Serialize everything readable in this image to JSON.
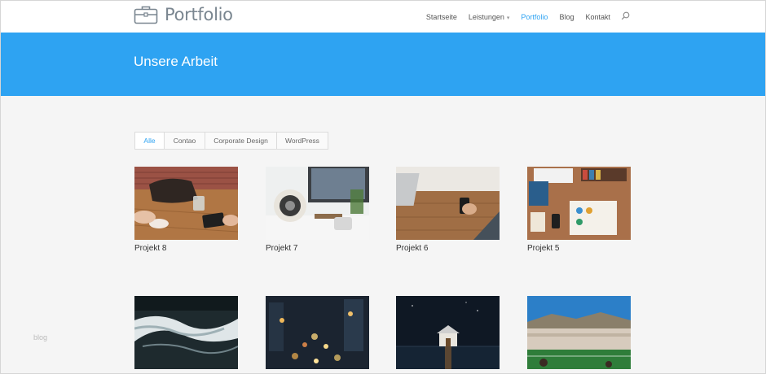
{
  "header": {
    "logo_text": "Portfolio",
    "nav": [
      {
        "label": "Startseite",
        "active": false
      },
      {
        "label": "Leistungen",
        "active": false,
        "has_dropdown": true
      },
      {
        "label": "Portfolio",
        "active": true
      },
      {
        "label": "Blog",
        "active": false
      },
      {
        "label": "Kontakt",
        "active": false
      }
    ],
    "search_icon": "search-icon"
  },
  "banner": {
    "title": "Unsere Arbeit",
    "color": "#2ea3f2"
  },
  "filters": [
    {
      "label": "Alle",
      "active": true
    },
    {
      "label": "Contao",
      "active": false
    },
    {
      "label": "Corporate Design",
      "active": false
    },
    {
      "label": "WordPress",
      "active": false
    }
  ],
  "projects": [
    {
      "title": "Projekt 8",
      "image": "meeting-table-photo"
    },
    {
      "title": "Projekt 7",
      "image": "desk-speaker-photo"
    },
    {
      "title": "Projekt 6",
      "image": "phone-on-table-photo"
    },
    {
      "title": "Projekt 5",
      "image": "design-desk-photo"
    },
    {
      "title": "",
      "image": "ocean-waves-photo"
    },
    {
      "title": "",
      "image": "city-night-lights-photo"
    },
    {
      "title": "",
      "image": "boathouse-night-photo"
    },
    {
      "title": "",
      "image": "stadium-crowd-photo"
    }
  ],
  "watermark": "blog",
  "accent_color": "#2ea3f2"
}
